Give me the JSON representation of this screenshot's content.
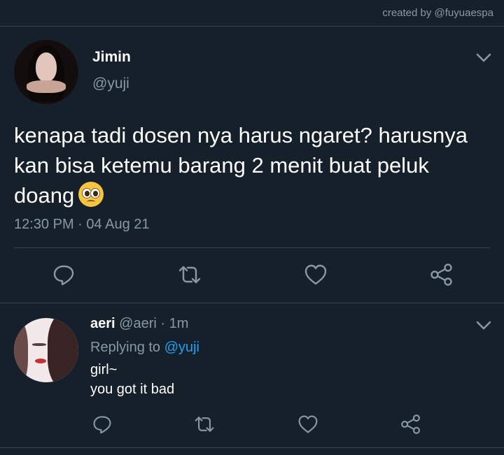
{
  "credit": "created by @fuyuaespa",
  "main_tweet": {
    "name": "Jimin",
    "handle": "@yuji",
    "text": "kenapa tadi dosen nya harus ngaret? harusnya kan bisa ketemu barang 2 menit buat peluk doang",
    "emoji": "pleading-face",
    "time": "12:30 PM",
    "separator": "·",
    "date": "04 Aug 21",
    "actions": [
      "reply-icon",
      "retweet-icon",
      "like-icon",
      "share-icon"
    ]
  },
  "reply": {
    "name": "aeri",
    "handle": "@aeri",
    "separator": "·",
    "time": "1m",
    "replying_prefix": "Replying to",
    "replying_to": "@yuji",
    "line1": "girl~",
    "line2": "you got it bad",
    "actions": [
      "reply-icon",
      "retweet-icon",
      "like-icon",
      "share-icon"
    ]
  },
  "colors": {
    "background": "#15202b",
    "secondary_text": "#8899a6",
    "link": "#1da1f2",
    "divider": "#38444d"
  }
}
